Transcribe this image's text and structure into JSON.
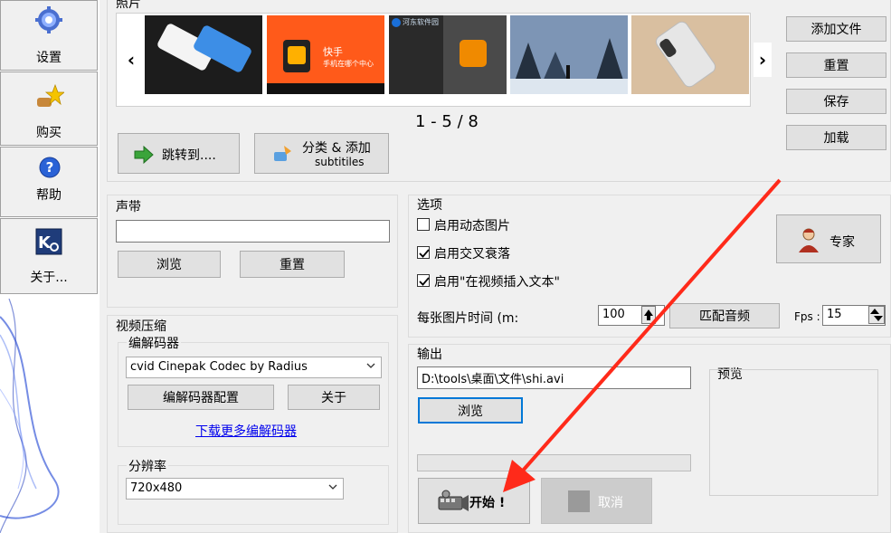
{
  "sidebar": {
    "items": [
      {
        "label": "设置",
        "icon": "gear-icon"
      },
      {
        "label": "购买",
        "icon": "buy-star-icon"
      },
      {
        "label": "帮助",
        "icon": "help-icon"
      },
      {
        "label": "关于...",
        "icon": "about-logo-icon"
      }
    ]
  },
  "photos": {
    "group_label": "照片",
    "prev": "‹",
    "next": "›",
    "page_indicator": "1 - 5 / 8",
    "add_file": "添加文件",
    "reset": "重置",
    "save": "保存",
    "load": "加载",
    "jump_to": "跳转到....",
    "classify_add_1": "分类 & 添加",
    "classify_add_2": "subtitiles",
    "thumb2_text1": "快手",
    "thumb2_text2": "手机在哪个中心",
    "thumb3_text1": "河东软件园"
  },
  "sound": {
    "group_label": "声带",
    "value": "",
    "browse": "浏览",
    "reset": "重置"
  },
  "options": {
    "group_label": "选项",
    "dynamic_image": {
      "label": "启用动态图片",
      "checked": false
    },
    "crossfade": {
      "label": "启用交叉衰落",
      "checked": true
    },
    "insert_text": {
      "label": "启用\"在视频插入文本\"",
      "checked": true
    },
    "time_per_image_label": "每张图片时间 (m:",
    "time_per_image_value": "100",
    "match_audio": "匹配音频",
    "fps_label": "Fps :",
    "fps_value": "15",
    "expert": "专家"
  },
  "compression": {
    "group_label": "视频压缩",
    "codec_label": "编解码器",
    "codec_value": "cvid Cinepak Codec by Radius",
    "codec_config": "编解码器配置",
    "about": "关于",
    "download_link": "下载更多编解码器",
    "resolution_label": "分辨率",
    "resolution_value": "720x480"
  },
  "output": {
    "group_label": "输出",
    "path": "D:\\tools\\桌面\\文件\\shi.avi",
    "browse": "浏览",
    "preview_label": "预览",
    "progress": 0,
    "start": "开始 !",
    "cancel": "取消"
  },
  "colors": {
    "accent_link": "#0000ee",
    "annotation_arrow": "#ff2a1a",
    "focus_border": "#0078d7"
  }
}
